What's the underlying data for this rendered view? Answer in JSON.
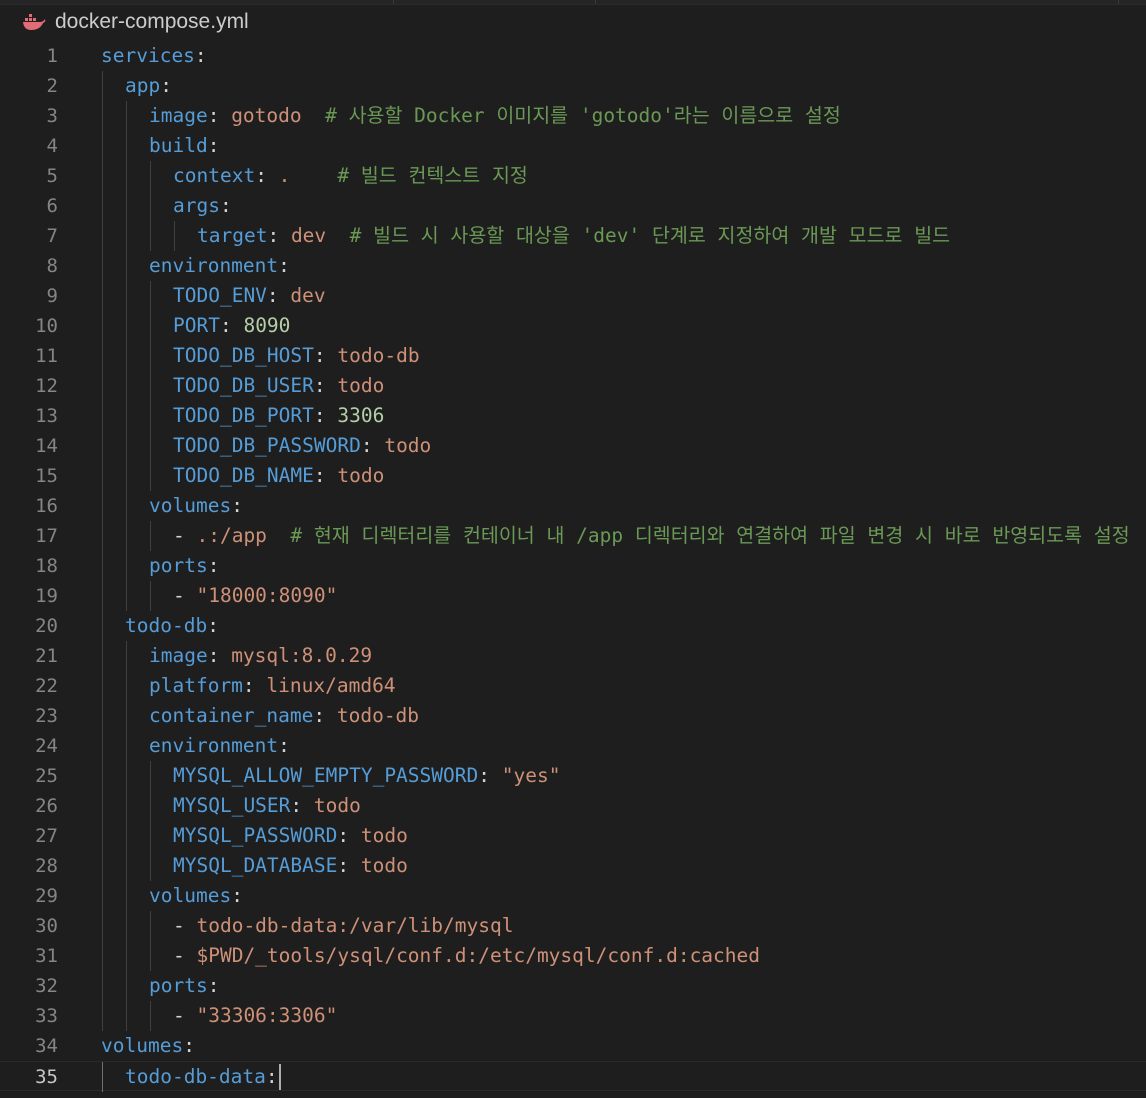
{
  "tab": {
    "filename": "docker-compose.yml",
    "icon": "docker-icon"
  },
  "colors": {
    "background": "#1e1e1e",
    "key": "#569cd6",
    "string": "#ce9178",
    "number": "#b5cea8",
    "comment": "#6a9955"
  },
  "editor": {
    "current_line": 35,
    "lines": [
      {
        "n": "1",
        "indent": 0,
        "tokens": [
          {
            "t": "services",
            "c": "k"
          },
          {
            "t": ":",
            "c": "p"
          }
        ]
      },
      {
        "n": "2",
        "indent": 1,
        "tokens": [
          {
            "t": "app",
            "c": "k"
          },
          {
            "t": ":",
            "c": "p"
          }
        ]
      },
      {
        "n": "3",
        "indent": 2,
        "tokens": [
          {
            "t": "image",
            "c": "k"
          },
          {
            "t": ": ",
            "c": "p"
          },
          {
            "t": "gotodo",
            "c": "s"
          },
          {
            "t": "  # 사용할 Docker 이미지를 'gotodo'라는 이름으로 설정",
            "c": "c"
          }
        ]
      },
      {
        "n": "4",
        "indent": 2,
        "tokens": [
          {
            "t": "build",
            "c": "k"
          },
          {
            "t": ":",
            "c": "p"
          }
        ]
      },
      {
        "n": "5",
        "indent": 3,
        "tokens": [
          {
            "t": "context",
            "c": "k"
          },
          {
            "t": ": ",
            "c": "p"
          },
          {
            "t": ".",
            "c": "s"
          },
          {
            "t": "    # 빌드 컨텍스트 지정",
            "c": "c"
          }
        ]
      },
      {
        "n": "6",
        "indent": 3,
        "tokens": [
          {
            "t": "args",
            "c": "k"
          },
          {
            "t": ":",
            "c": "p"
          }
        ]
      },
      {
        "n": "7",
        "indent": 4,
        "tokens": [
          {
            "t": "target",
            "c": "k"
          },
          {
            "t": ": ",
            "c": "p"
          },
          {
            "t": "dev",
            "c": "s"
          },
          {
            "t": "  # 빌드 시 사용할 대상을 'dev' 단계로 지정하여 개발 모드로 빌드",
            "c": "c"
          }
        ]
      },
      {
        "n": "8",
        "indent": 2,
        "tokens": [
          {
            "t": "environment",
            "c": "k"
          },
          {
            "t": ":",
            "c": "p"
          }
        ]
      },
      {
        "n": "9",
        "indent": 3,
        "tokens": [
          {
            "t": "TODO_ENV",
            "c": "k"
          },
          {
            "t": ": ",
            "c": "p"
          },
          {
            "t": "dev",
            "c": "s"
          }
        ]
      },
      {
        "n": "10",
        "indent": 3,
        "tokens": [
          {
            "t": "PORT",
            "c": "k"
          },
          {
            "t": ": ",
            "c": "p"
          },
          {
            "t": "8090",
            "c": "n"
          }
        ]
      },
      {
        "n": "11",
        "indent": 3,
        "tokens": [
          {
            "t": "TODO_DB_HOST",
            "c": "k"
          },
          {
            "t": ": ",
            "c": "p"
          },
          {
            "t": "todo-db",
            "c": "s"
          }
        ]
      },
      {
        "n": "12",
        "indent": 3,
        "tokens": [
          {
            "t": "TODO_DB_USER",
            "c": "k"
          },
          {
            "t": ": ",
            "c": "p"
          },
          {
            "t": "todo",
            "c": "s"
          }
        ]
      },
      {
        "n": "13",
        "indent": 3,
        "tokens": [
          {
            "t": "TODO_DB_PORT",
            "c": "k"
          },
          {
            "t": ": ",
            "c": "p"
          },
          {
            "t": "3306",
            "c": "n"
          }
        ]
      },
      {
        "n": "14",
        "indent": 3,
        "tokens": [
          {
            "t": "TODO_DB_PASSWORD",
            "c": "k"
          },
          {
            "t": ": ",
            "c": "p"
          },
          {
            "t": "todo",
            "c": "s"
          }
        ]
      },
      {
        "n": "15",
        "indent": 3,
        "tokens": [
          {
            "t": "TODO_DB_NAME",
            "c": "k"
          },
          {
            "t": ": ",
            "c": "p"
          },
          {
            "t": "todo",
            "c": "s"
          }
        ]
      },
      {
        "n": "16",
        "indent": 2,
        "tokens": [
          {
            "t": "volumes",
            "c": "k"
          },
          {
            "t": ":",
            "c": "p"
          }
        ]
      },
      {
        "n": "17",
        "indent": 3,
        "tokens": [
          {
            "t": "- ",
            "c": "p"
          },
          {
            "t": ".:/app",
            "c": "s"
          },
          {
            "t": "  # 현재 디렉터리를 컨테이너 내 /app 디렉터리와 연결하여 파일 변경 시 바로 반영되도록 설정",
            "c": "c"
          }
        ]
      },
      {
        "n": "18",
        "indent": 2,
        "tokens": [
          {
            "t": "ports",
            "c": "k"
          },
          {
            "t": ":",
            "c": "p"
          }
        ]
      },
      {
        "n": "19",
        "indent": 3,
        "tokens": [
          {
            "t": "- ",
            "c": "p"
          },
          {
            "t": "\"18000:8090\"",
            "c": "s"
          }
        ]
      },
      {
        "n": "20",
        "indent": 1,
        "tokens": [
          {
            "t": "todo-db",
            "c": "k"
          },
          {
            "t": ":",
            "c": "p"
          }
        ]
      },
      {
        "n": "21",
        "indent": 2,
        "tokens": [
          {
            "t": "image",
            "c": "k"
          },
          {
            "t": ": ",
            "c": "p"
          },
          {
            "t": "mysql:8.0.29",
            "c": "s"
          }
        ]
      },
      {
        "n": "22",
        "indent": 2,
        "tokens": [
          {
            "t": "platform",
            "c": "k"
          },
          {
            "t": ": ",
            "c": "p"
          },
          {
            "t": "linux/amd64",
            "c": "s"
          }
        ]
      },
      {
        "n": "23",
        "indent": 2,
        "tokens": [
          {
            "t": "container_name",
            "c": "k"
          },
          {
            "t": ": ",
            "c": "p"
          },
          {
            "t": "todo-db",
            "c": "s"
          }
        ]
      },
      {
        "n": "24",
        "indent": 2,
        "tokens": [
          {
            "t": "environment",
            "c": "k"
          },
          {
            "t": ":",
            "c": "p"
          }
        ]
      },
      {
        "n": "25",
        "indent": 3,
        "tokens": [
          {
            "t": "MYSQL_ALLOW_EMPTY_PASSWORD",
            "c": "k"
          },
          {
            "t": ": ",
            "c": "p"
          },
          {
            "t": "\"yes\"",
            "c": "s"
          }
        ]
      },
      {
        "n": "26",
        "indent": 3,
        "tokens": [
          {
            "t": "MYSQL_USER",
            "c": "k"
          },
          {
            "t": ": ",
            "c": "p"
          },
          {
            "t": "todo",
            "c": "s"
          }
        ]
      },
      {
        "n": "27",
        "indent": 3,
        "tokens": [
          {
            "t": "MYSQL_PASSWORD",
            "c": "k"
          },
          {
            "t": ": ",
            "c": "p"
          },
          {
            "t": "todo",
            "c": "s"
          }
        ]
      },
      {
        "n": "28",
        "indent": 3,
        "tokens": [
          {
            "t": "MYSQL_DATABASE",
            "c": "k"
          },
          {
            "t": ": ",
            "c": "p"
          },
          {
            "t": "todo",
            "c": "s"
          }
        ]
      },
      {
        "n": "29",
        "indent": 2,
        "tokens": [
          {
            "t": "volumes",
            "c": "k"
          },
          {
            "t": ":",
            "c": "p"
          }
        ]
      },
      {
        "n": "30",
        "indent": 3,
        "tokens": [
          {
            "t": "- ",
            "c": "p"
          },
          {
            "t": "todo-db-data:/var/lib/mysql",
            "c": "s"
          }
        ]
      },
      {
        "n": "31",
        "indent": 3,
        "tokens": [
          {
            "t": "- ",
            "c": "p"
          },
          {
            "t": "$PWD/_tools/ysql/conf.d:/etc/mysql/conf.d:cached",
            "c": "s"
          }
        ]
      },
      {
        "n": "32",
        "indent": 2,
        "tokens": [
          {
            "t": "ports",
            "c": "k"
          },
          {
            "t": ":",
            "c": "p"
          }
        ]
      },
      {
        "n": "33",
        "indent": 3,
        "tokens": [
          {
            "t": "- ",
            "c": "p"
          },
          {
            "t": "\"33306:3306\"",
            "c": "s"
          }
        ]
      },
      {
        "n": "34",
        "indent": 0,
        "tokens": [
          {
            "t": "volumes",
            "c": "k"
          },
          {
            "t": ":",
            "c": "p"
          }
        ]
      },
      {
        "n": "35",
        "indent": 1,
        "tokens": [
          {
            "t": "todo-db-data",
            "c": "k"
          },
          {
            "t": ":",
            "c": "p"
          }
        ]
      }
    ]
  }
}
